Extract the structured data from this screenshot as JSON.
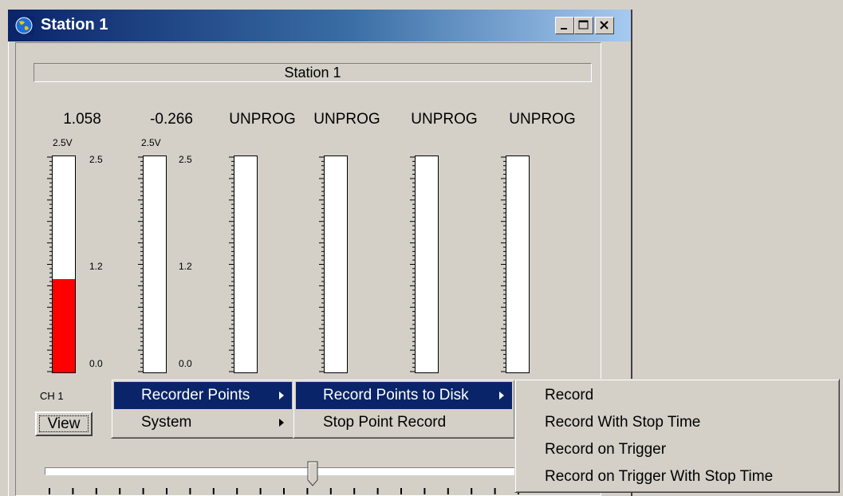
{
  "window": {
    "title": "Station 1",
    "icon": "globe-icon"
  },
  "panel": {
    "caption": "Station 1"
  },
  "channels": [
    {
      "readout": "1.058",
      "range": "2.5V",
      "scale": [
        "2.5",
        "1.2",
        "0.0"
      ],
      "fill_fraction": 0.43
    },
    {
      "readout": "-0.266",
      "range": "2.5V",
      "scale": [
        "2.5",
        "1.2",
        "0.0"
      ],
      "fill_fraction": 0
    },
    {
      "readout": "UNPROG"
    },
    {
      "readout": "UNPROG"
    },
    {
      "readout": "UNPROG"
    },
    {
      "readout": "UNPROG"
    }
  ],
  "channel_label": "CH 1",
  "view_button": "View",
  "slider": {
    "value_fraction": 0.56
  },
  "menus": {
    "main": [
      {
        "label": "Recorder Points",
        "highlighted": true,
        "submenu": true
      },
      {
        "label": "System",
        "highlighted": false,
        "submenu": true
      }
    ],
    "recorder_points": [
      {
        "label": "Record Points to Disk",
        "highlighted": true,
        "submenu": true
      },
      {
        "label": "Stop Point Record",
        "highlighted": false,
        "submenu": false
      }
    ],
    "record_to_disk": [
      {
        "label": "Record"
      },
      {
        "label": "Record With Stop Time"
      },
      {
        "label": "Record on Trigger"
      },
      {
        "label": "Record on Trigger With Stop Time"
      }
    ]
  },
  "colors": {
    "title_start": "#0a246a",
    "title_end": "#a6caf0",
    "level_fill": "#ff0000",
    "menu_highlight": "#0a246a",
    "face": "#d4d0c8"
  }
}
